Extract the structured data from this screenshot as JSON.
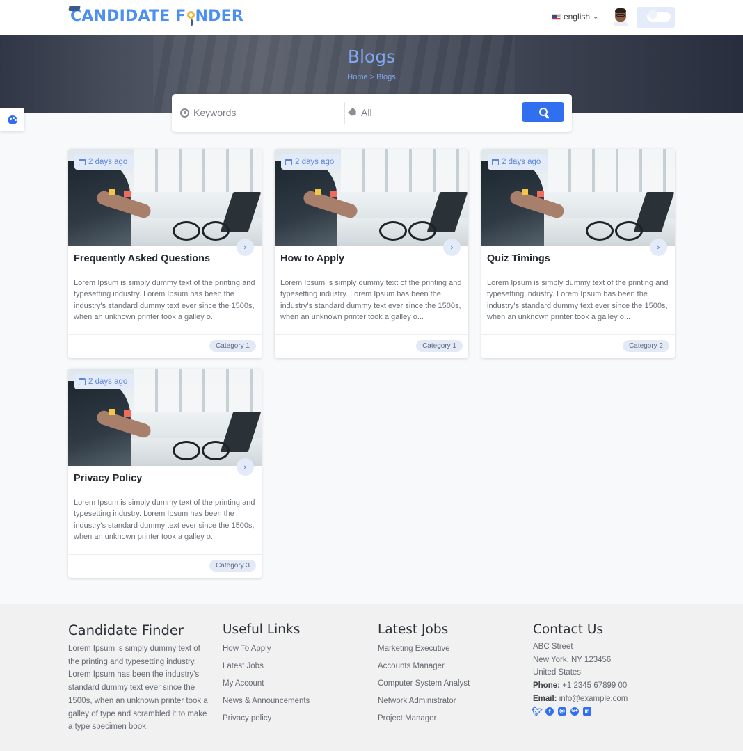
{
  "header": {
    "logo_text_before": "CANDIDATE F",
    "logo_text_after": "NDER",
    "language": "english",
    "brand_color": "#4d8ff0"
  },
  "hero": {
    "title": "Blogs",
    "breadcrumb": "Home > Blogs"
  },
  "search": {
    "keywords_placeholder": "Keywords",
    "category_value": "All"
  },
  "cards": [
    {
      "date": "2 days ago",
      "title": "Frequently Asked Questions",
      "excerpt": "Lorem Ipsum is simply dummy text of the printing and typesetting industry. Lorem Ipsum has been the industry's standard dummy text ever since the 1500s, when an unknown printer took a galley o...",
      "category": "Category 1"
    },
    {
      "date": "2 days ago",
      "title": "How to Apply",
      "excerpt": "Lorem Ipsum is simply dummy text of the printing and typesetting industry. Lorem Ipsum has been the industry's standard dummy text ever since the 1500s, when an unknown printer took a galley o...",
      "category": "Category 1"
    },
    {
      "date": "2 days ago",
      "title": "Quiz Timings",
      "excerpt": "Lorem Ipsum is simply dummy text of the printing and typesetting industry. Lorem Ipsum has been the industry's standard dummy text ever since the 1500s, when an unknown printer took a galley o...",
      "category": "Category 2"
    },
    {
      "date": "2 days ago",
      "title": "Privacy Policy",
      "excerpt": "Lorem Ipsum is simply dummy text of the printing and typesetting industry. Lorem Ipsum has been the industry's standard dummy text ever since the 1500s, when an unknown printer took a galley o...",
      "category": "Category 3"
    }
  ],
  "footer": {
    "about": {
      "title": "Candidate Finder",
      "text": "Lorem Ipsum is simply dummy text of the printing and typesetting industry. Lorem Ipsum has been the industry's standard dummy text ever since the 1500s, when an unknown printer took a galley of type and scrambled it to make a type specimen book."
    },
    "useful_links": {
      "title": "Useful Links",
      "items": [
        "How To Apply",
        "Latest Jobs",
        "My Account",
        "News & Announcements",
        "Privacy policy"
      ]
    },
    "latest_jobs": {
      "title": "Latest Jobs",
      "items": [
        "Marketing Executive",
        "Accounts Manager",
        "Computer System Analyst",
        "Network Administrator",
        "Project Manager"
      ]
    },
    "contact": {
      "title": "Contact Us",
      "street": "ABC Street",
      "city": "New York, NY 123456",
      "country": "United States",
      "phone_label": "Phone:",
      "phone": "+1 2345 67899 00",
      "email_label": "Email:",
      "email": "info@example.com",
      "social_icons": [
        "twitter-icon",
        "facebook-icon",
        "instagram-icon",
        "google-plus-icon",
        "linkedin-icon"
      ]
    }
  },
  "colors": {
    "accent": "#2f6ff0",
    "hero_text": "#7fa7f2",
    "badge_bg": "#e4ebf8"
  }
}
